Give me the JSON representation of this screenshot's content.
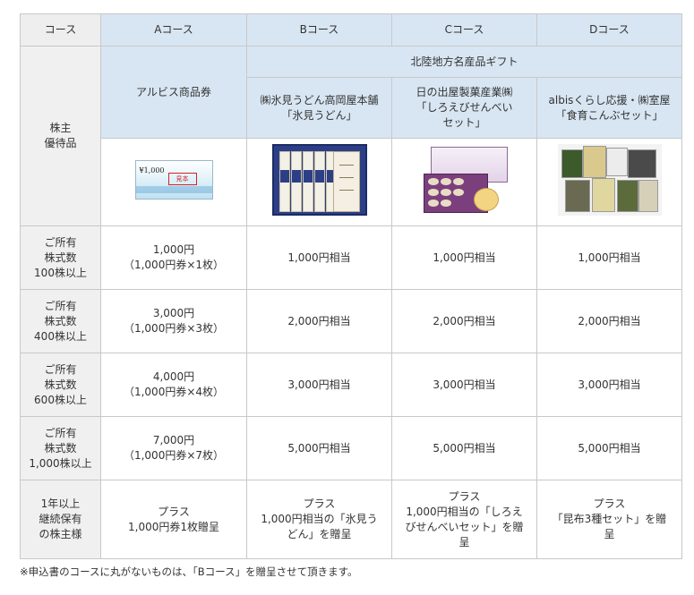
{
  "table": {
    "header": {
      "course": "コース",
      "a": "Aコース",
      "b": "Bコース",
      "c": "Cコース",
      "d": "Dコース"
    },
    "item_label": "株主\n優待品",
    "group_header": "北陸地方名産品ギフト",
    "items": {
      "a": "アルビス商品券",
      "b": "㈱氷見うどん高岡屋本舗\n「氷見うどん」",
      "c": "日の出屋製菓産業㈱\n「しろえびせんべい\nセット」",
      "d": "albisくらし応援・㈱室屋\n「食育こんぶセット」"
    },
    "images": {
      "voucher_amount": "¥1,000",
      "voucher_stamp": "見本"
    },
    "rows": [
      {
        "label": "ご所有\n株式数\n100株以上",
        "a": "1,000円\n（1,000円券×1枚）",
        "b": "1,000円相当",
        "c": "1,000円相当",
        "d": "1,000円相当"
      },
      {
        "label": "ご所有\n株式数\n400株以上",
        "a": "3,000円\n（1,000円券×3枚）",
        "b": "2,000円相当",
        "c": "2,000円相当",
        "d": "2,000円相当"
      },
      {
        "label": "ご所有\n株式数\n600株以上",
        "a": "4,000円\n（1,000円券×4枚）",
        "b": "3,000円相当",
        "c": "3,000円相当",
        "d": "3,000円相当"
      },
      {
        "label": "ご所有\n株式数\n1,000株以上",
        "a": "7,000円\n（1,000円券×7枚）",
        "b": "5,000円相当",
        "c": "5,000円相当",
        "d": "5,000円相当"
      }
    ],
    "bonus": {
      "label": "1年以上\n継続保有\nの株主様",
      "a": "プラス\n1,000円券1枚贈呈",
      "b": "プラス\n1,000円相当の「氷見う\nどん」を贈呈",
      "c": "プラス\n1,000円相当の「しろえ\nびせんべいセット」を贈\n呈",
      "d": "プラス\n「昆布3種セット」を贈\n呈"
    }
  },
  "note": "※申込書のコースに丸がないものは、「Bコース」を贈呈させて頂きます。",
  "colors": {
    "header_bg": "#eeeeee",
    "blue_bg": "#d8e6f3",
    "border": "#c8c8c8"
  }
}
